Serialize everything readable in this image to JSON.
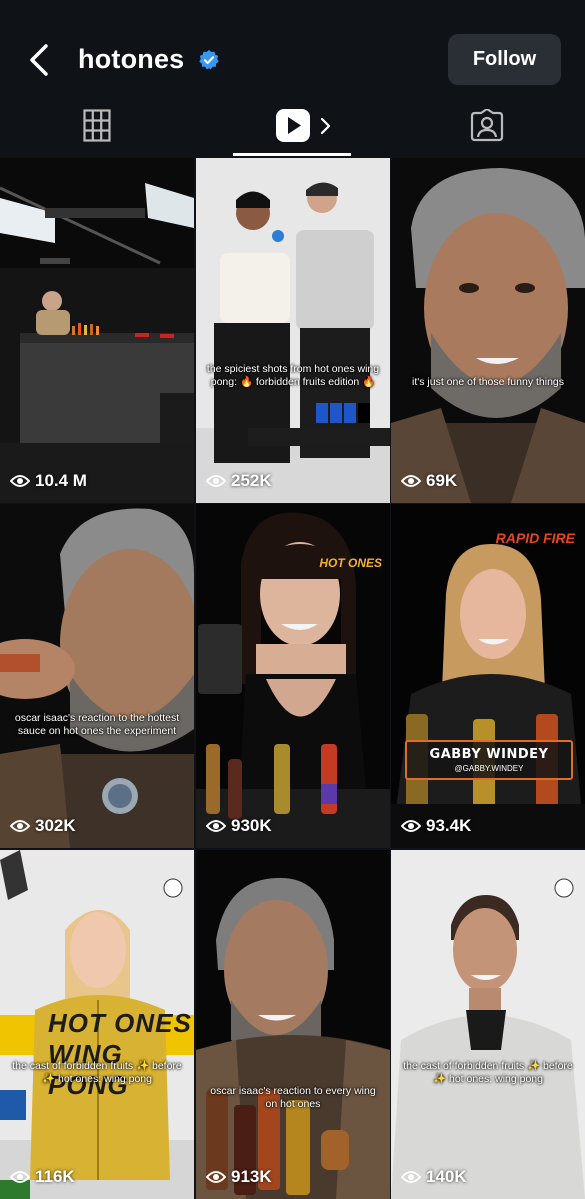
{
  "header": {
    "username": "hotones",
    "follow_label": "Follow"
  },
  "tabs": [
    "grid",
    "reels",
    "tagged"
  ],
  "colors": {
    "background": "#0f1216",
    "follow_bg": "#2a2e35",
    "verified": "#3897f0",
    "name_card_border": "#e26b2a"
  },
  "tiles": [
    {
      "views": "10.4 M",
      "caption": ""
    },
    {
      "views": "252K",
      "caption": "the spiciest shots from hot ones wing pong: 🔥 forbidden fruits edition 🔥"
    },
    {
      "views": "69K",
      "caption": "it's just one of those funny things"
    },
    {
      "views": "302K",
      "caption": "oscar isaac's reaction to the hottest sauce on hot ones the experiment"
    },
    {
      "views": "930K",
      "caption": "",
      "logo": "HOT ONES"
    },
    {
      "views": "93.4K",
      "caption": "",
      "logo": "RAPID FIRE",
      "name_card": {
        "name": "GABBY WINDEY",
        "handle": "@GABBY.WINDEY"
      }
    },
    {
      "views": "116K",
      "caption": "the cast of forbidden fruits ✨ before ✨ hot ones: wing pong",
      "banner": "HOT ONES WING PONG"
    },
    {
      "views": "913K",
      "caption": "oscar isaac's reaction to every wing on hot ones"
    },
    {
      "views": "140K",
      "caption": "the cast of forbidden fruits ✨ before ✨ hot ones: wing pong"
    }
  ]
}
